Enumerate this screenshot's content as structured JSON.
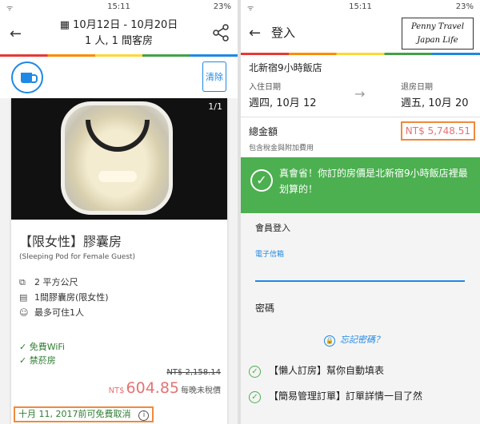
{
  "status": {
    "time": "15:11",
    "battery": "23%",
    "signal": "ᯤ"
  },
  "left": {
    "dates": "10月12日 - 10月20日",
    "guests": "1 人, 1 間客房",
    "clear_label": "清除",
    "photo_count": "1/1",
    "room_name": "【限女性】膠囊房",
    "room_en": "(Sleeping Pod for Female Guest)",
    "features": [
      "2 平方公尺",
      "1間膠囊房(限女性)",
      "最多可住1人"
    ],
    "amenities": [
      "免費WiFi",
      "禁菸房"
    ],
    "old_price": "NT$ 2,158.14",
    "currency": "NT$",
    "price": "604.85",
    "price_note": "每晚未稅價",
    "cancel": "十月 11, 2017前可免費取消"
  },
  "right": {
    "title": "登入",
    "logo_line1": "Penny Travel",
    "logo_line2": "Japan Life",
    "hotel": "北新宿9小時飯店",
    "checkin_label": "入住日期",
    "checkin": "週四, 10月 12",
    "checkout_label": "退房日期",
    "checkout": "週五, 10月 20",
    "total_label": "總金額",
    "total_price": "NT$ 5,748.51",
    "tax_note": "包含稅金與附加費用",
    "banner": "真會省！你訂的房價是北新宿9小時飯店裡最划算的！",
    "member_login": "會員登入",
    "email_label": "電子信箱",
    "password_label": "密碼",
    "forgot": "忘記密碼？",
    "perks": [
      "【懶人訂房】幫你自動填表",
      "【簡易管理訂單】訂單詳情一目了然"
    ]
  }
}
